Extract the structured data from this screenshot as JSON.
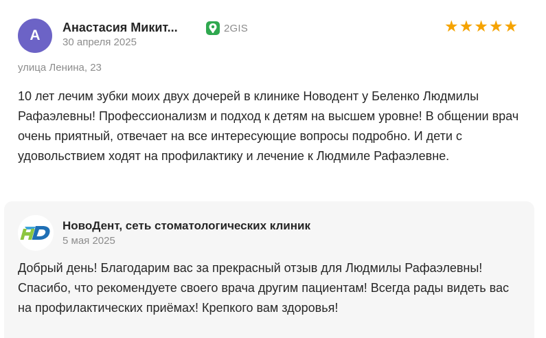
{
  "review": {
    "avatar_letter": "А",
    "avatar_color": "#6c63c6",
    "author_name": "Анастасия Микит...",
    "date": "30 апреля 2025",
    "source_label": "2GIS",
    "source_icon": "2gis-logo-icon",
    "source_color": "#2fa84f",
    "rating": 5,
    "rating_max": 5,
    "star_glyph": "★",
    "star_color": "#f5a300",
    "address": "улица Ленина, 23",
    "text": "10 лет лечим зубки моих двух дочерей в клинике Новодент у Беленко Людмилы Рафаэлевны! Профессионализм и подход к детям на высшем уровне! В общении врач очень приятный, отвечает на все интересующие вопросы подробно. И дети с удовольствием ходят на профилактику и лечение к Людмиле Рафаэлевне."
  },
  "reply": {
    "company_name": "НовоДент, сеть стоматологических клиник",
    "company_logo_icon": "novodent-hd-logo-icon",
    "date": "5 мая 2025",
    "text": "Добрый день! Благодарим вас за прекрасный отзыв для Людмилы Рафаэлевны! Спасибо, что рекомендуете своего врача другим пациентам! Всегда рады видеть вас на профилактических приёмах! Крепкого вам здоровья!"
  }
}
